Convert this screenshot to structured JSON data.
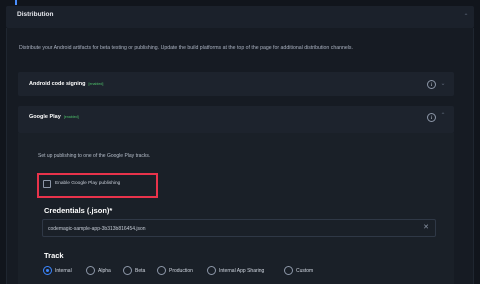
{
  "distribution": {
    "title": "Distribution",
    "description": "Distribute your Android artifacts for beta testing or publishing. Update the build platforms at the top of the page for additional distribution channels."
  },
  "android_signing": {
    "title": "Android code signing",
    "badge": "[enabled]",
    "info_icon": "i"
  },
  "google_play": {
    "title": "Google Play",
    "badge": "[enabled]",
    "info_icon": "i",
    "description": "Set up publishing to one of the Google Play tracks.",
    "enable_checkbox_label": "Enable Google Play publishing",
    "enable_checked": false,
    "credentials_title": "Credentials (.json)*",
    "credentials_value": "codemagic-sample-app-3b313b816454.json",
    "track_title": "Track",
    "tracks": [
      "Internal",
      "Alpha",
      "Beta",
      "Production",
      "Internal App Sharing",
      "Custom"
    ],
    "selected_track": "Internal"
  },
  "colors": {
    "accent": "#3c86ff",
    "highlight": "#e8334b",
    "enabled_badge": "#4ec26b"
  }
}
